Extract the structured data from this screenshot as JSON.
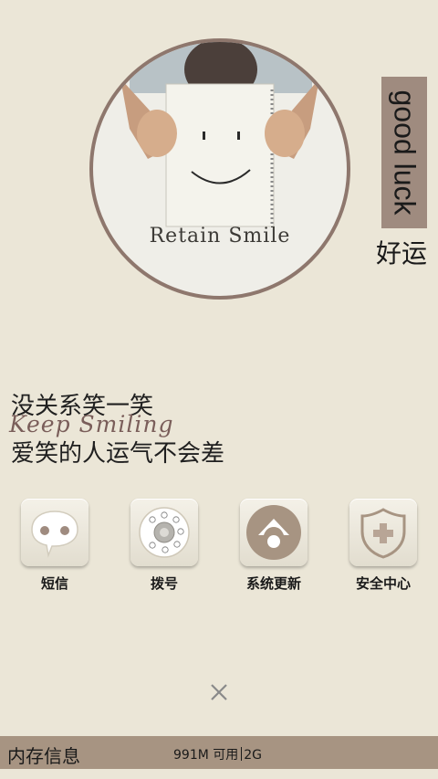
{
  "photo": {
    "caption": "Retain Smile"
  },
  "luck_tag": {
    "english": "good luck",
    "chinese": "好运"
  },
  "slogan": {
    "line1": "没关系笑一笑",
    "script": "Keep Smiling",
    "line2": "爱笑的人运气不会差"
  },
  "apps": [
    {
      "label": "短信",
      "icon": "chat-bubble-icon"
    },
    {
      "label": "拨号",
      "icon": "rotary-dial-icon"
    },
    {
      "label": "系统更新",
      "icon": "update-icon"
    },
    {
      "label": "安全中心",
      "icon": "shield-plus-icon"
    }
  ],
  "close": {
    "icon": "close-icon"
  },
  "memory": {
    "title": "内存信息",
    "available": "991M 可用",
    "total": "2G"
  },
  "colors": {
    "background": "#ebe6d7",
    "accent_brown": "#9f8b7f",
    "bar_brown": "#a79482",
    "circle_border": "#8e776d"
  }
}
